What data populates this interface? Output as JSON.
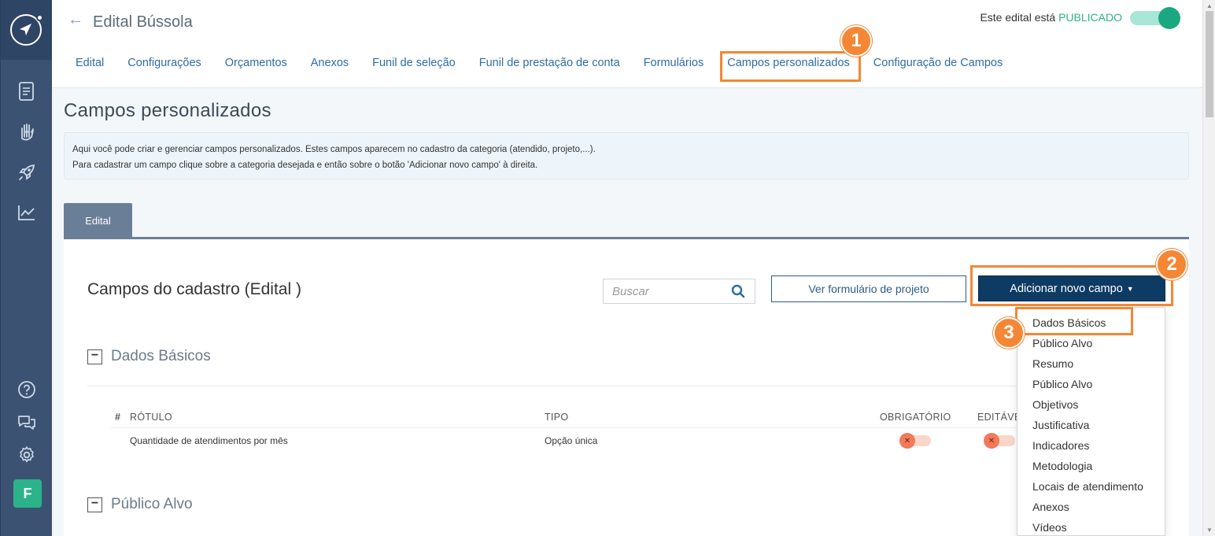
{
  "sidebar": {
    "icons": [
      "compass-icon",
      "document-icon",
      "hand-heart-icon",
      "rocket-icon",
      "chart-icon",
      "help-icon",
      "chat-icon",
      "gear-icon"
    ],
    "avatar_letter": "F"
  },
  "header": {
    "title": "Edital Bússola",
    "status_prefix": "Este edital está",
    "status_value": "PUBLICADO",
    "published": true,
    "tabs": [
      {
        "label": "Edital"
      },
      {
        "label": "Configurações"
      },
      {
        "label": "Orçamentos"
      },
      {
        "label": "Anexos"
      },
      {
        "label": "Funil de seleção"
      },
      {
        "label": "Funil de prestação de conta"
      },
      {
        "label": "Formulários"
      },
      {
        "label": "Campos personalizados",
        "active": true
      },
      {
        "label": "Configuração de Campos"
      }
    ]
  },
  "main": {
    "title": "Campos personalizados",
    "info_line1": "Aqui você pode criar e gerenciar campos personalizados. Estes campos aparecem no cadastro da categoria (atendido, projeto,...).",
    "info_line2": "Para cadastrar um campo clique sobre a categoria desejada e então sobre o botão 'Adicionar novo campo' à direita.",
    "category_tab": "Edital",
    "panel_title": "Campos do cadastro (Edital )",
    "search_placeholder": "Buscar",
    "btn_view_form": "Ver formulário de projeto",
    "btn_add_field": "Adicionar novo campo",
    "groups": [
      {
        "label": "Dados Básicos",
        "toggle": "−",
        "columns": [
          "#",
          "RÓTULO",
          "TIPO",
          "OBRIGATÓRIO",
          "EDITÁVE"
        ],
        "rows": [
          {
            "label": "Quantidade de atendimentos por mês",
            "type": "Opção única",
            "required": false,
            "editable": false
          }
        ]
      },
      {
        "label": "Público Alvo",
        "toggle": "−"
      }
    ]
  },
  "dropdown": {
    "items": [
      "Dados Básicos",
      "Público Alvo",
      "Resumo",
      "Público Alvo",
      "Objetivos",
      "Justificativa",
      "Indicadores",
      "Metodologia",
      "Locais de atendimento",
      "Anexos",
      "Vídeos"
    ]
  },
  "annotations": {
    "badge1": "1",
    "badge2": "2",
    "badge3": "3",
    "color": "#f58634"
  },
  "colors": {
    "sidebar": "#3b5273",
    "primary_button": "#0e3b63",
    "link": "#2e6da4",
    "published": "#2db38a"
  }
}
